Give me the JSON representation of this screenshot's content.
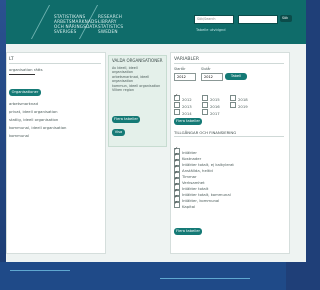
{
  "header": {
    "left_col": [
      "STATISTIKANS",
      "ARBETSMARKNADS-",
      "OCH NÄRINGSDATA",
      "SVERIGES"
    ],
    "center_col": [
      "RESEARCH",
      "LIBRARY",
      "STATISTICS",
      "SWEDEN"
    ],
    "search_placeholder": "Sök/Search",
    "search_btn": "Sök",
    "help_link": "Tabelle utvidgnd"
  },
  "left_panel": {
    "title": "LT",
    "org_text": "organisation rätts",
    "btn": "Organisationer",
    "items": [
      "arbetsmarknad",
      "privat, ideell organisation",
      "statlig, ideell organisation",
      "kommunal, ideell organisation",
      "kommunal"
    ]
  },
  "middle_panel": {
    "title": "VALDA ORGANISATIONER",
    "lines": [
      "Av Ideell, ideell",
      "organisation",
      "arbetsmarknad, ideell",
      "organisation",
      "kommun, ideell organisation",
      "Vilken region"
    ],
    "btn1": "Flera tabeller",
    "btn2": "Visa"
  },
  "right_panel": {
    "title": "VARIABLER",
    "from_label": "Startår",
    "to_label": "Slutår",
    "from_value": "2012",
    "to_value": "2012",
    "go_btn": "Tabell",
    "years": [
      "2012",
      "2013",
      "2014",
      "2015",
      "2016",
      "2017",
      "2018",
      "2019"
    ],
    "years_checked": [
      true,
      false,
      false,
      false,
      false,
      false,
      false,
      false
    ],
    "btn_fetch": "Flera tabeller",
    "category_title": "TILLGÅNGAR OCH FINANSIERING",
    "variables": [
      "Intäkter",
      "Kostnader",
      "Intäkter totalt, ej kalkylerat",
      "Anställda, heltid",
      "Timmar",
      "Verksamhet",
      "Intäkter totalt",
      "Intäkter totalt, kommunal",
      "Intäkter, kommunal",
      "Kapital"
    ],
    "variables_checked": [
      true,
      true,
      true,
      true,
      true,
      true,
      true,
      true,
      true,
      true
    ],
    "btn_last": "Flera tabeller"
  }
}
